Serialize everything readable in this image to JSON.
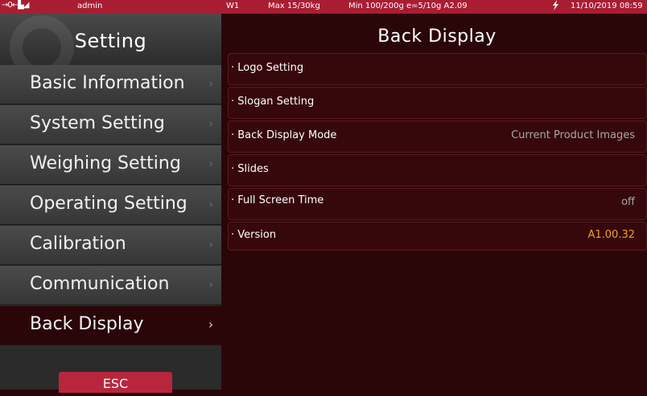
{
  "statusbar": {
    "indicator": "→0←▙◢",
    "user": "admin",
    "scale_id": "W1",
    "max_capacity": "Max 15/30kg",
    "min_capacity": "Min 100/200g e=5/10g A2.09",
    "power_icon": "lightning-bolt",
    "datetime": "11/10/2019 08:59"
  },
  "sidebar": {
    "title": "Setting",
    "items": [
      {
        "label": "Basic Information"
      },
      {
        "label": "System Setting"
      },
      {
        "label": "Weighing Setting"
      },
      {
        "label": "Operating Setting"
      },
      {
        "label": "Calibration"
      },
      {
        "label": "Communication"
      },
      {
        "label": "Back Display"
      }
    ],
    "active_index": 6,
    "esc_label": "ESC"
  },
  "main": {
    "title": "Back Display",
    "rows": [
      {
        "label": "· Logo Setting",
        "value": ""
      },
      {
        "label": "· Slogan Setting",
        "value": ""
      },
      {
        "label": "· Back Display Mode",
        "value": "Current Product Images"
      },
      {
        "label": "· Slides",
        "value": ""
      },
      {
        "label": "· Full Screen Time",
        "value": "off"
      },
      {
        "label": "· Version",
        "value": "A1.00.32"
      }
    ]
  },
  "colors": {
    "statusbar": "#a91d33",
    "background": "#2a0608",
    "accent_value": "#f0a020",
    "esc_button": "#b8263d"
  },
  "chevron": "›"
}
